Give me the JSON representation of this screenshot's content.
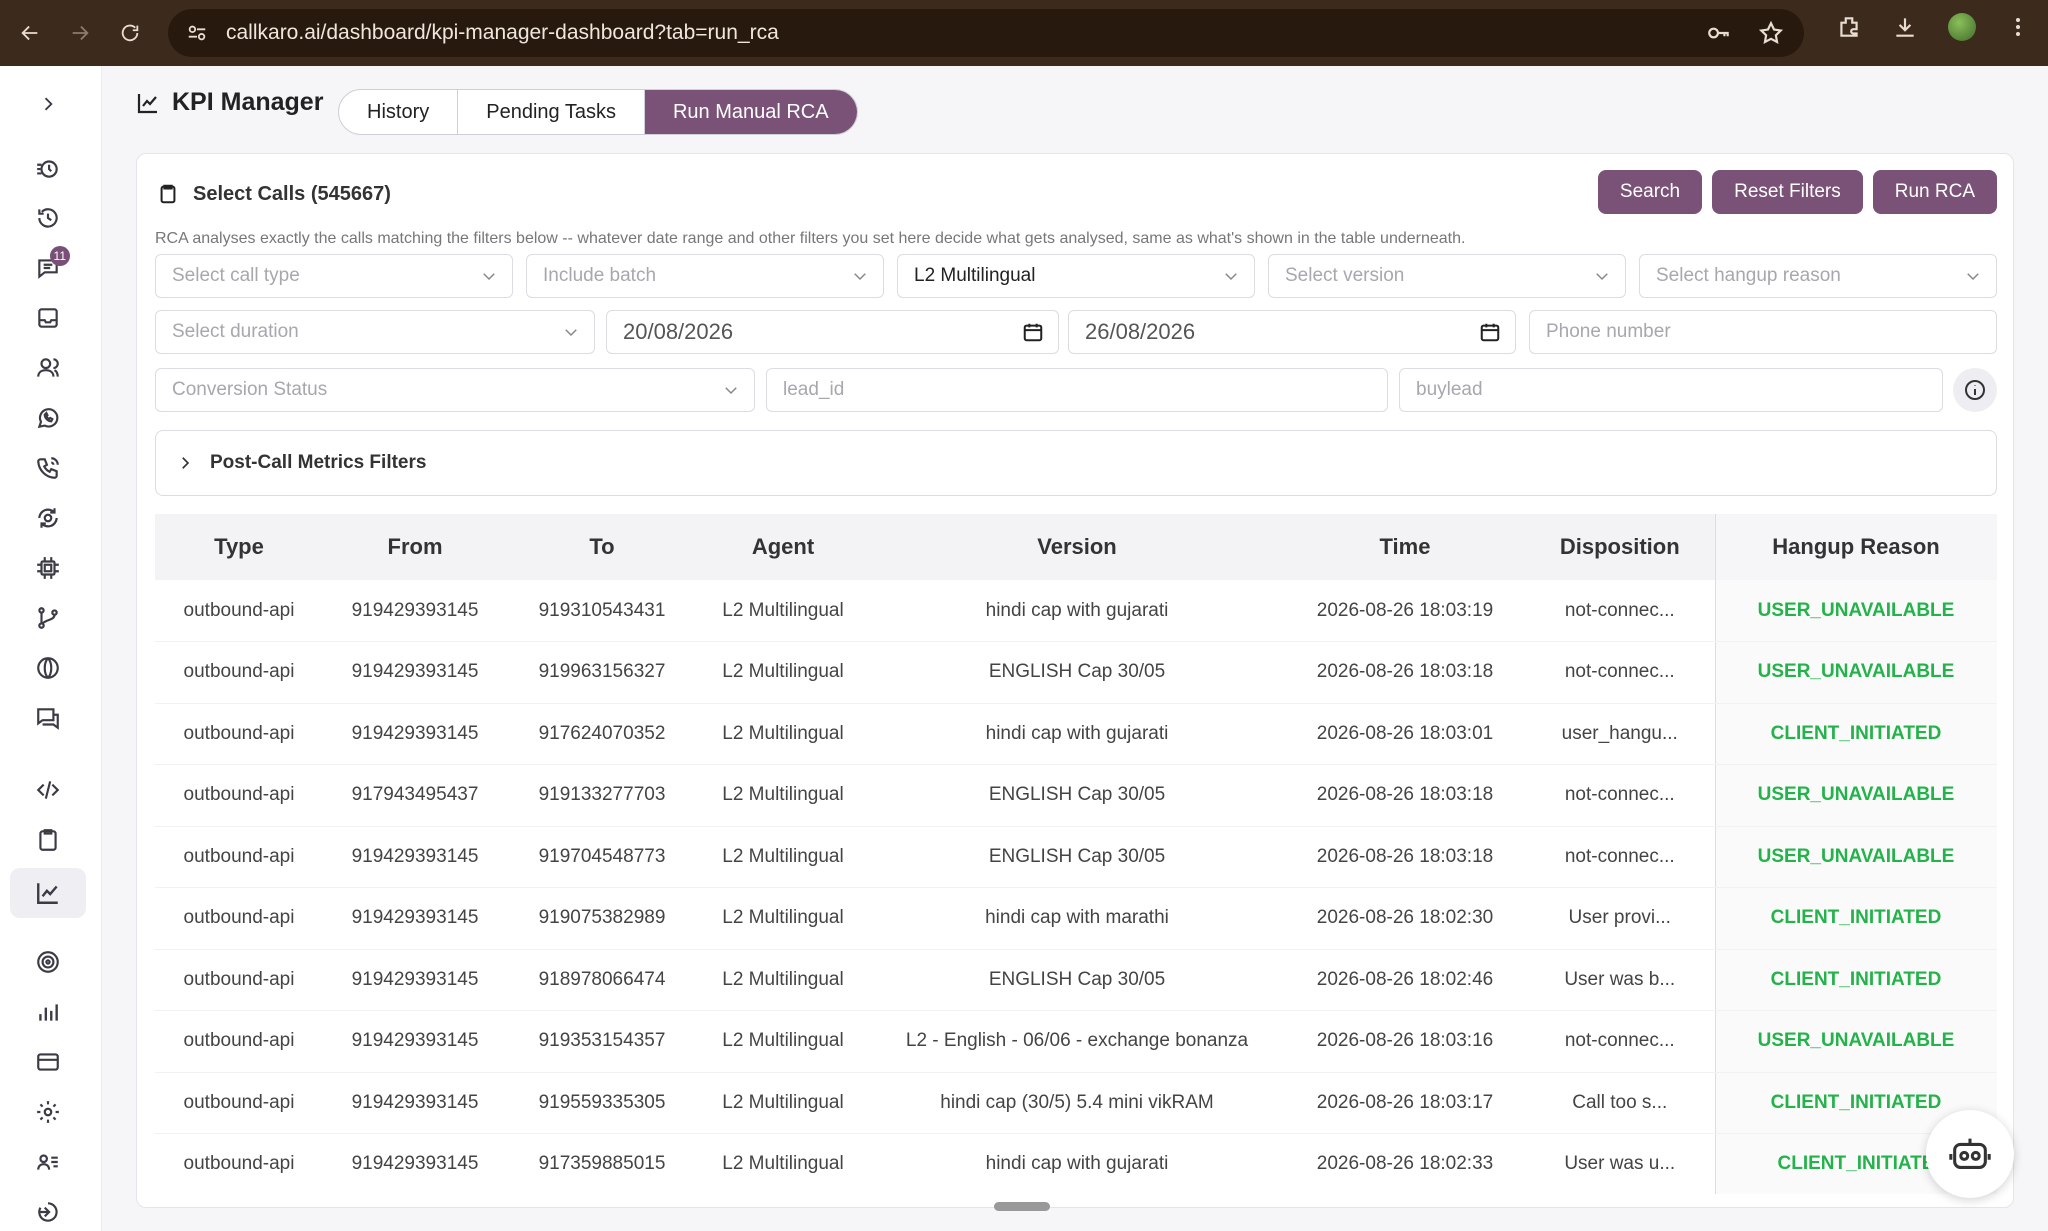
{
  "browser": {
    "url": "callkaro.ai/dashboard/kpi-manager-dashboard?tab=run_rca"
  },
  "sidebar": {
    "badge_count": "11",
    "items": [
      {
        "name": "timer-icon"
      },
      {
        "name": "history-icon"
      },
      {
        "name": "chat-icon"
      },
      {
        "name": "inbox-icon"
      },
      {
        "name": "users-icon"
      },
      {
        "name": "whatsapp-icon"
      },
      {
        "name": "phone-icon"
      },
      {
        "name": "monitor-icon"
      },
      {
        "name": "chip-icon"
      },
      {
        "name": "branch-icon"
      },
      {
        "name": "globe-icon"
      },
      {
        "name": "messages-icon"
      },
      {
        "name": "code-icon"
      },
      {
        "name": "clipboard-icon"
      },
      {
        "name": "chart-icon"
      },
      {
        "name": "target-icon"
      },
      {
        "name": "bar-chart-icon"
      },
      {
        "name": "card-icon"
      },
      {
        "name": "settings-icon"
      },
      {
        "name": "contacts-icon"
      },
      {
        "name": "logout-icon"
      }
    ]
  },
  "header": {
    "title": "KPI Manager",
    "tabs": [
      {
        "label": "History"
      },
      {
        "label": "Pending Tasks"
      },
      {
        "label": "Run Manual RCA"
      }
    ]
  },
  "card": {
    "select_calls_label": "Select Calls (545667)",
    "buttons": {
      "search": "Search",
      "reset": "Reset Filters",
      "run": "Run RCA"
    },
    "help_text": "RCA analyses exactly the calls matching the filters below -- whatever date range and other filters you set here decide what gets analysed, same as what's shown in the table underneath."
  },
  "filters": {
    "call_type": "Select call type",
    "batch": "Include batch",
    "agent": "L2 Multilingual",
    "version": "Select version",
    "hangup_reason": "Select hangup reason",
    "duration": "Select duration",
    "date_from": "20/08/2026",
    "date_to": "26/08/2026",
    "phone": "Phone number",
    "conversion": "Conversion Status",
    "lead_id": "lead_id",
    "buylead": "buylead"
  },
  "post_call": {
    "label": "Post-Call Metrics Filters"
  },
  "table": {
    "headers": [
      "Type",
      "From",
      "To",
      "Agent",
      "Version",
      "Time",
      "Disposition",
      "Hangup Reason"
    ],
    "rows": [
      [
        "outbound-api",
        "919429393145",
        "919310543431",
        "L2 Multilingual",
        "hindi cap with gujarati",
        "2026-08-26 18:03:19",
        "not-connec...",
        "USER_UNAVAILABLE"
      ],
      [
        "outbound-api",
        "919429393145",
        "919963156327",
        "L2 Multilingual",
        "ENGLISH Cap 30/05",
        "2026-08-26 18:03:18",
        "not-connec...",
        "USER_UNAVAILABLE"
      ],
      [
        "outbound-api",
        "919429393145",
        "917624070352",
        "L2 Multilingual",
        "hindi cap with gujarati",
        "2026-08-26 18:03:01",
        "user_hangu...",
        "CLIENT_INITIATED"
      ],
      [
        "outbound-api",
        "917943495437",
        "919133277703",
        "L2 Multilingual",
        "ENGLISH Cap 30/05",
        "2026-08-26 18:03:18",
        "not-connec...",
        "USER_UNAVAILABLE"
      ],
      [
        "outbound-api",
        "919429393145",
        "919704548773",
        "L2 Multilingual",
        "ENGLISH Cap 30/05",
        "2026-08-26 18:03:18",
        "not-connec...",
        "USER_UNAVAILABLE"
      ],
      [
        "outbound-api",
        "919429393145",
        "919075382989",
        "L2 Multilingual",
        "hindi cap with marathi",
        "2026-08-26 18:02:30",
        "User provi...",
        "CLIENT_INITIATED"
      ],
      [
        "outbound-api",
        "919429393145",
        "918978066474",
        "L2 Multilingual",
        "ENGLISH Cap 30/05",
        "2026-08-26 18:02:46",
        "User was b...",
        "CLIENT_INITIATED"
      ],
      [
        "outbound-api",
        "919429393145",
        "919353154357",
        "L2 Multilingual",
        "L2 - English - 06/06 - exchange bonanza",
        "2026-08-26 18:03:16",
        "not-connec...",
        "USER_UNAVAILABLE"
      ],
      [
        "outbound-api",
        "919429393145",
        "919559335305",
        "L2 Multilingual",
        "hindi cap (30/5) 5.4 mini vikRAM",
        "2026-08-26 18:03:17",
        "Call too s...",
        "CLIENT_INITIATED"
      ],
      [
        "outbound-api",
        "919429393145",
        "917359885015",
        "L2 Multilingual",
        "hindi cap with gujarati",
        "2026-08-26 18:02:33",
        "User was u...",
        "CLIENT_INITIATE"
      ]
    ]
  }
}
